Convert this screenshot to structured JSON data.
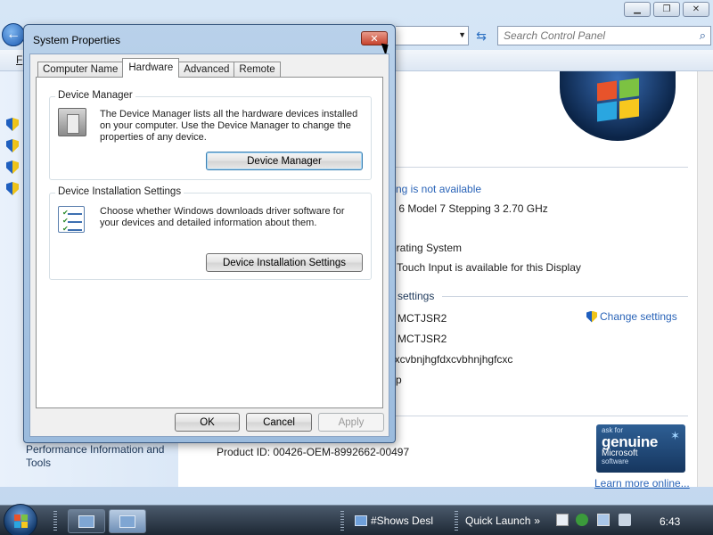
{
  "control_panel": {
    "search_placeholder": "Search Control Panel",
    "menu_fragment": "F",
    "lines": {
      "rating": "ting is not available",
      "processor": "y 6 Model 7 Stepping 3   2.70 GHz",
      "system_type": "erating System",
      "pen_touch": "r Touch Input is available for this Display",
      "section_settings": "settings",
      "computer_name": "MCTJSR2",
      "full_computer_name": "MCTJSR2",
      "description": "lxcvbnjhgfdxcvbhnjhgfcxc",
      "workgroup": "p"
    },
    "change_settings": "Change settings",
    "performance_link": "Performance Information and Tools",
    "product_id": "Product ID: 00426-OEM-8992662-00497",
    "genuine": {
      "ask": "ask for",
      "genuine": "genuine",
      "microsoft": "Microsoft",
      "software": "software"
    },
    "learn_more": "Learn more online..."
  },
  "dialog": {
    "title": "System Properties",
    "close_glyph": "✕",
    "tabs": [
      "Computer Name",
      "Hardware",
      "Advanced",
      "Remote"
    ],
    "active_tab": "Hardware",
    "device_manager": {
      "title": "Device Manager",
      "description": "The Device Manager lists all the hardware devices installed on your computer. Use the Device Manager to change the properties of any device.",
      "button": "Device Manager"
    },
    "device_installation": {
      "title": "Device Installation Settings",
      "description": "Choose whether Windows downloads driver software for your devices and detailed information about them.",
      "button": "Device Installation Settings"
    },
    "buttons": {
      "ok": "OK",
      "cancel": "Cancel",
      "apply": "Apply"
    }
  },
  "taskbar": {
    "window_item": "#Shows Desl",
    "quick_launch": "Quick Launch",
    "clock": "6:43"
  },
  "colors": {
    "link": "#2a64b8",
    "taskbar": "#1d2834",
    "dialog_frame": "#9bbbdd"
  }
}
